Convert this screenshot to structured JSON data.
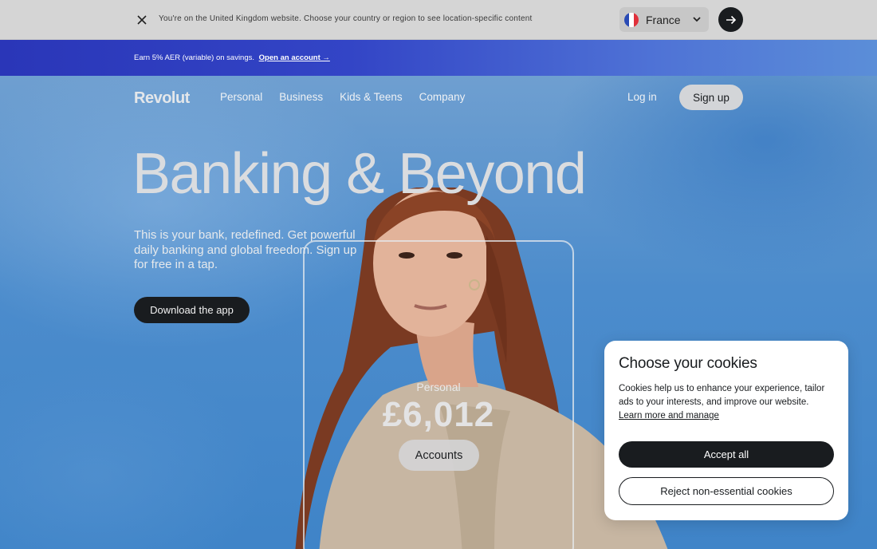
{
  "country_banner": {
    "message": "You're on the United Kingdom website. Choose your country or region to see location-specific content",
    "selected_country": "France",
    "flag_colors": [
      "#2a4bb5",
      "#ffffff",
      "#e0303b"
    ],
    "close_icon": "close-icon",
    "submit_icon": "arrow-right-icon"
  },
  "promo": {
    "text": "Earn 5% AER (variable) on savings.",
    "link": "Open an account →"
  },
  "nav": {
    "logo": "Revolut",
    "items": [
      "Personal",
      "Business",
      "Kids & Teens",
      "Company"
    ],
    "login": "Log in",
    "signup": "Sign up"
  },
  "hero": {
    "headline": "Banking & Beyond",
    "subtext": "This is your bank, redefined. Get powerful daily banking and global freedom. Sign up for free in a tap.",
    "cta": "Download the app",
    "account_label": "Personal",
    "account_amount": "£6,012",
    "accounts_button": "Accounts"
  },
  "cookie_dialog": {
    "title": "Choose your cookies",
    "body": "Cookies help us to enhance your experience, tailor ads to your interests, and improve our website.",
    "learn_more": "Learn more and manage",
    "accept": "Accept all",
    "reject": "Reject non-essential cookies"
  },
  "colors": {
    "primary_dark": "#191c1f",
    "promo_blue": "#2a36b8",
    "sky_blue": "#3f82c4"
  }
}
